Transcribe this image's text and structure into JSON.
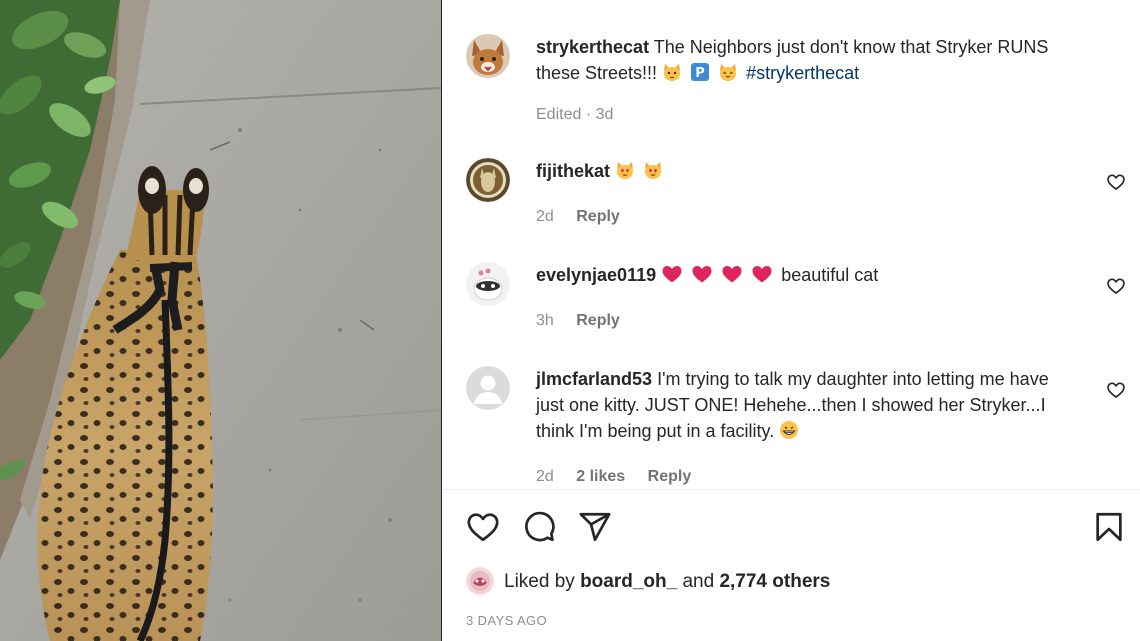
{
  "caption": {
    "username": "strykerthecat",
    "text": "The Neighbors just don't know that Stryker RUNS these Streets!!!",
    "emojis": [
      "cat-face-emoji",
      "p-button-emoji",
      "cat-face-emoji"
    ],
    "hashtag": "#strykerthecat",
    "meta": "Edited · 3d"
  },
  "comments": [
    {
      "username": "fijithekat",
      "text": "",
      "emojis": [
        "heart-eyes-cat-emoji",
        "heart-eyes-cat-emoji"
      ],
      "time": "2d",
      "likes": "",
      "reply": "Reply"
    },
    {
      "username": "evelynjae0119",
      "text": "beautiful cat",
      "emojis": [
        "red-heart-emoji",
        "red-heart-emoji",
        "red-heart-emoji",
        "red-heart-emoji"
      ],
      "time": "3h",
      "likes": "",
      "reply": "Reply"
    },
    {
      "username": "jlmcfarland53",
      "text": "I'm trying to talk my daughter into letting me have just one kitty. JUST ONE! Hehehe...then I showed her Stryker...I think I'm being put in a facility.",
      "emojis": [
        "grinning-face-emoji"
      ],
      "time": "2d",
      "likes": "2 likes",
      "reply": "Reply"
    }
  ],
  "actions": {
    "icons": [
      "heart-icon",
      "comment-icon",
      "share-icon",
      "bookmark-icon"
    ]
  },
  "likes": {
    "prefix": "Liked by",
    "user": "board_oh_",
    "and": "and",
    "others": "2,774 others"
  },
  "timestamp": "3 DAYS AGO",
  "colors": {
    "text": "#262626",
    "muted": "#8e8e8e",
    "hashtag": "#00376b",
    "heart_emoji": "#e0245e"
  }
}
